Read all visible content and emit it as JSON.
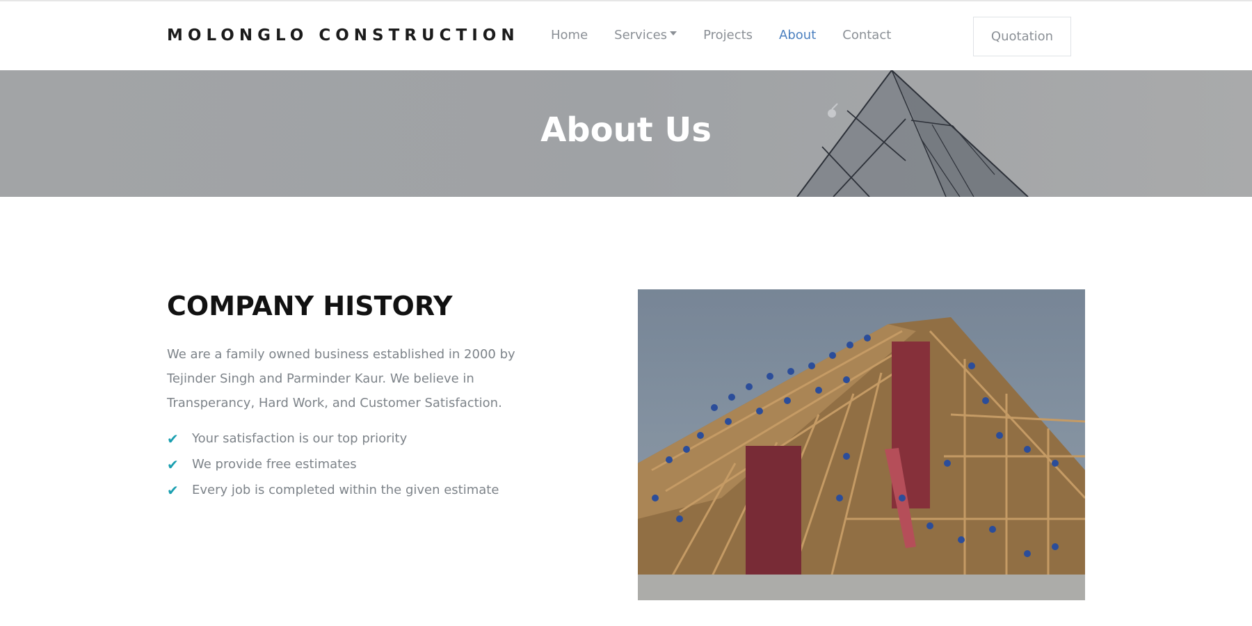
{
  "header": {
    "brand": "MOLONGLO CONSTRUCTION",
    "nav": [
      {
        "label": "Home"
      },
      {
        "label": "Services"
      },
      {
        "label": "Projects"
      },
      {
        "label": "About"
      },
      {
        "label": "Contact"
      }
    ],
    "active_nav": "About",
    "quotation_label": "Quotation"
  },
  "hero": {
    "title": "About Us"
  },
  "history": {
    "title": "COMPANY HISTORY",
    "text": "We are a family owned business established in 2000 by Tejinder Singh and Parminder Kaur. We believe in Transperancy, Hard Work, and Customer Satisfaction.",
    "points": [
      "Your satisfaction is our top priority",
      "We provide free estimates",
      "Every  job is completed within the given estimate"
    ]
  },
  "colors": {
    "accent": "#4a7fbf",
    "check": "#1a9fb0",
    "text_muted": "#7d8389",
    "hero_bg": "#a2a4a6"
  },
  "icons": {
    "dropdown": "caret-down-icon",
    "bullet": "check-icon"
  }
}
